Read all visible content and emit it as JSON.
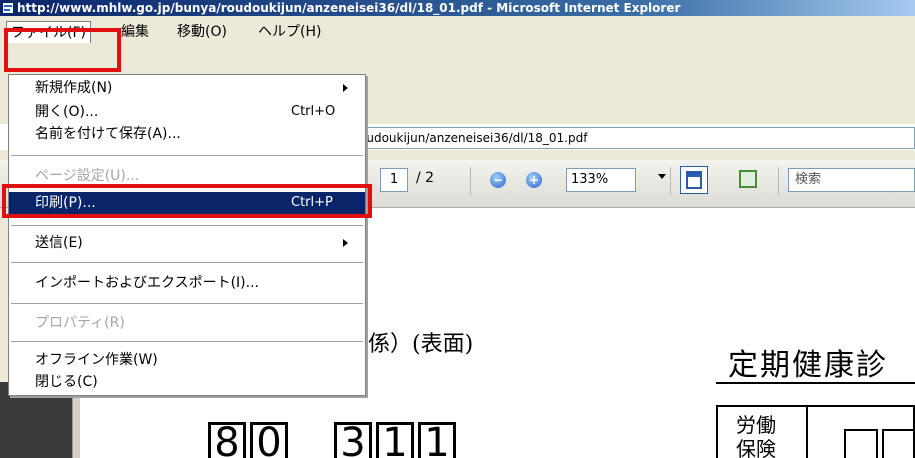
{
  "window": {
    "title": "http://www.mhlw.go.jp/bunya/roudoukijun/anzeneisei36/dl/18_01.pdf - Microsoft Internet Explorer"
  },
  "menubar": {
    "items": [
      {
        "label": "ファイル(F)"
      },
      {
        "label": "編集"
      },
      {
        "label": "移動(O)"
      },
      {
        "label": "ヘルプ(H)"
      }
    ]
  },
  "address": {
    "value": "oudoukijun/anzeneisei36/dl/18_01.pdf"
  },
  "pdf_toolbar": {
    "page_current": "1",
    "page_total": "/ 2",
    "zoom": "133%",
    "search_placeholder": "検索",
    "zoom_out_icon": "minus-icon",
    "zoom_in_icon": "plus-icon"
  },
  "file_menu": {
    "items": [
      {
        "label": "新規作成(N)",
        "shortcut": "",
        "submenu": true,
        "disabled": false
      },
      {
        "label": "開く(O)...",
        "shortcut": "Ctrl+O",
        "submenu": false,
        "disabled": false
      },
      {
        "label": "名前を付けて保存(A)...",
        "shortcut": "",
        "submenu": false,
        "disabled": false
      },
      {
        "label": "ページ設定(U)...",
        "shortcut": "",
        "submenu": false,
        "disabled": true
      },
      {
        "label": "印刷(P)...",
        "shortcut": "Ctrl+P",
        "submenu": false,
        "disabled": false,
        "highlighted": true
      },
      {
        "label": "送信(E)",
        "shortcut": "",
        "submenu": true,
        "disabled": false
      },
      {
        "label": "インポートおよびエクスポート(I)...",
        "shortcut": "",
        "submenu": false,
        "disabled": false
      },
      {
        "label": "プロパティ(R)",
        "shortcut": "",
        "submenu": false,
        "disabled": true
      },
      {
        "label": "オフライン作業(W)",
        "shortcut": "",
        "submenu": false,
        "disabled": false
      },
      {
        "label": "閉じる(C)",
        "shortcut": "",
        "submenu": false,
        "disabled": false
      }
    ]
  },
  "document": {
    "heading_left": "関係）(表面)",
    "heading_right": "定期健康診",
    "digits": [
      "8",
      "0",
      "3",
      "1",
      "1"
    ],
    "table_label": "労働保険"
  },
  "colors": {
    "highlight": "#0a246a",
    "annotation_red": "#e01010",
    "chrome": "#ece9d8"
  }
}
